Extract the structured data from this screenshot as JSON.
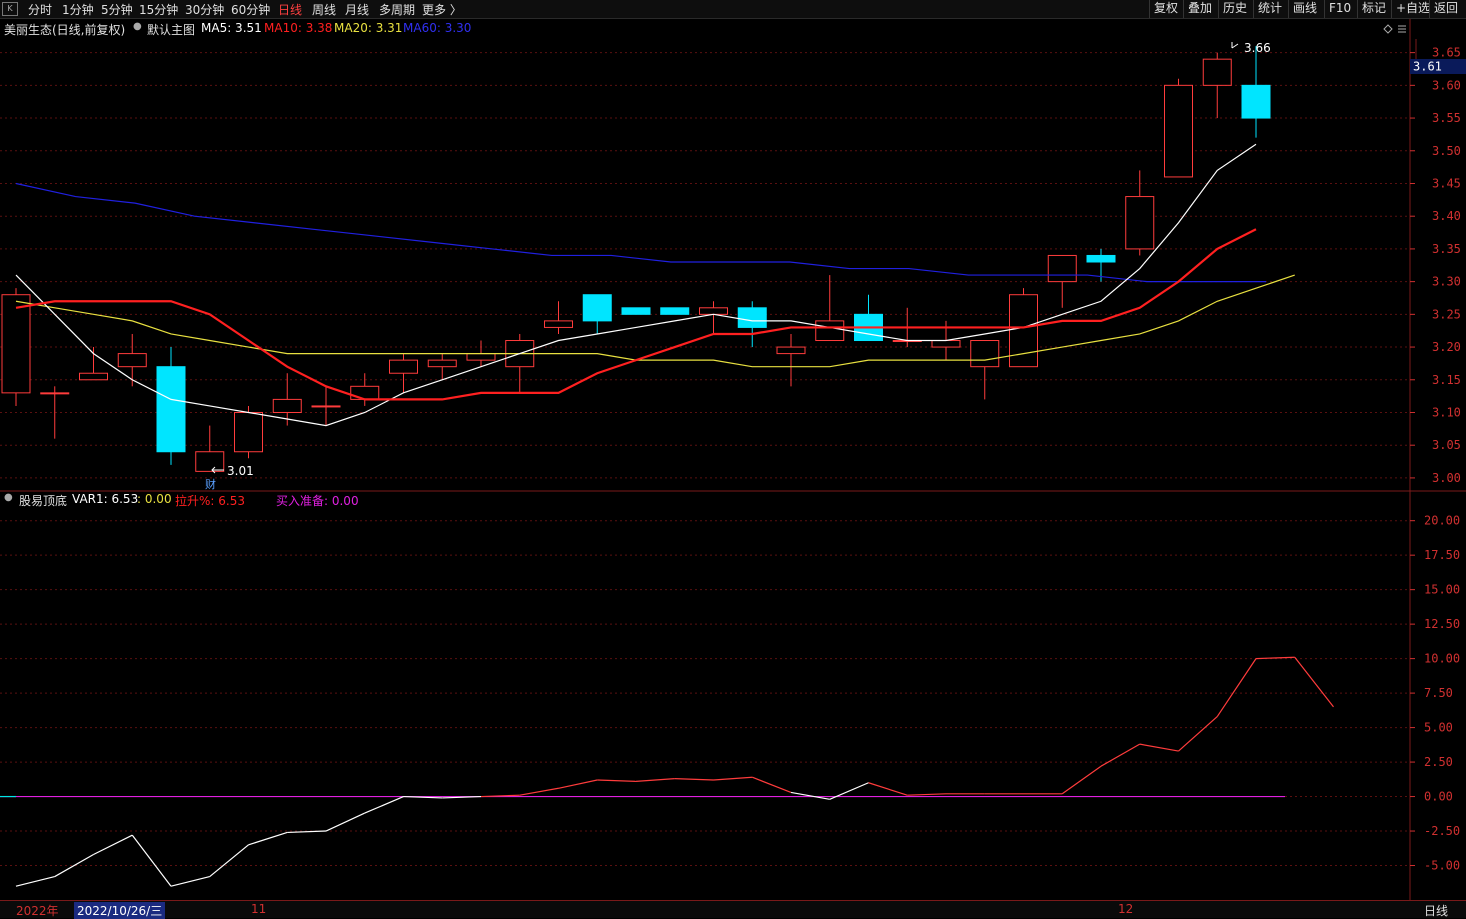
{
  "toolbar": {
    "periods": [
      "分时",
      "1分钟",
      "5分钟",
      "15分钟",
      "30分钟",
      "60分钟",
      "日线",
      "周线",
      "月线",
      "多周期",
      "更多 〉"
    ],
    "active_period": "日线",
    "right_buttons": [
      "复权",
      "叠加",
      "历史",
      "统计",
      "画线",
      "F10",
      "标记",
      "+自选",
      "返回"
    ]
  },
  "header": {
    "stock_title": "美丽生态(日线,前复权)",
    "template": "默认主图",
    "ma5": "MA5: 3.51",
    "ma10": "MA10: 3.38",
    "ma20": "MA20: 3.31",
    "ma60": "MA60: 3.30"
  },
  "indicator_header": {
    "name": "股易顶底",
    "var1": "VAR1: 6.53",
    "zero": ": 0.00",
    "lasheng": "拉升%: 6.53",
    "maiaru": "买入准备: 0.00"
  },
  "annotations": {
    "high": "3.66",
    "low": "3.01",
    "cai": "财",
    "current_price": "3.61"
  },
  "bottom_bar": {
    "year": "2022年",
    "date": "2022/10/26/三",
    "m11": "11",
    "m12": "12",
    "period": "日线"
  },
  "colors": {
    "up": "#ff3c3c",
    "down": "#00e5ff",
    "ma5": "#ffffff",
    "ma10": "#ff2020",
    "ma20": "#e8e040",
    "ma60": "#2020e0",
    "axis": "#d03030",
    "purple": "#e020e0"
  },
  "chart_data": [
    {
      "type": "candlestick",
      "title": "美丽生态(日线,前复权)",
      "y_ticks": [
        "3.65",
        "3.60",
        "3.55",
        "3.50",
        "3.45",
        "3.40",
        "3.35",
        "3.30",
        "3.25",
        "3.20",
        "3.15",
        "3.10",
        "3.05",
        "3.00"
      ],
      "ylim": [
        2.98,
        3.68
      ],
      "candles": [
        {
          "o": 3.13,
          "h": 3.29,
          "l": 3.11,
          "c": 3.28
        },
        {
          "o": 3.13,
          "h": 3.14,
          "l": 3.06,
          "c": 3.13
        },
        {
          "o": 3.15,
          "h": 3.2,
          "l": 3.15,
          "c": 3.16
        },
        {
          "o": 3.17,
          "h": 3.22,
          "l": 3.14,
          "c": 3.19
        },
        {
          "o": 3.17,
          "h": 3.2,
          "l": 3.02,
          "c": 3.04
        },
        {
          "o": 3.01,
          "h": 3.08,
          "l": 3.01,
          "c": 3.04
        },
        {
          "o": 3.04,
          "h": 3.11,
          "l": 3.03,
          "c": 3.1
        },
        {
          "o": 3.1,
          "h": 3.16,
          "l": 3.08,
          "c": 3.12
        },
        {
          "o": 3.11,
          "h": 3.14,
          "l": 3.08,
          "c": 3.11
        },
        {
          "o": 3.12,
          "h": 3.16,
          "l": 3.11,
          "c": 3.14
        },
        {
          "o": 3.16,
          "h": 3.19,
          "l": 3.13,
          "c": 3.18
        },
        {
          "o": 3.17,
          "h": 3.19,
          "l": 3.15,
          "c": 3.18
        },
        {
          "o": 3.18,
          "h": 3.21,
          "l": 3.17,
          "c": 3.19
        },
        {
          "o": 3.17,
          "h": 3.22,
          "l": 3.13,
          "c": 3.21
        },
        {
          "o": 3.23,
          "h": 3.27,
          "l": 3.22,
          "c": 3.24
        },
        {
          "o": 3.28,
          "h": 3.28,
          "l": 3.22,
          "c": 3.24
        },
        {
          "o": 3.26,
          "h": 3.26,
          "l": 3.25,
          "c": 3.25
        },
        {
          "o": 3.26,
          "h": 3.26,
          "l": 3.25,
          "c": 3.25
        },
        {
          "o": 3.25,
          "h": 3.27,
          "l": 3.22,
          "c": 3.26
        },
        {
          "o": 3.26,
          "h": 3.27,
          "l": 3.2,
          "c": 3.23
        },
        {
          "o": 3.19,
          "h": 3.22,
          "l": 3.14,
          "c": 3.2
        },
        {
          "o": 3.21,
          "h": 3.31,
          "l": 3.21,
          "c": 3.24
        },
        {
          "o": 3.25,
          "h": 3.28,
          "l": 3.21,
          "c": 3.21
        },
        {
          "o": 3.21,
          "h": 3.26,
          "l": 3.2,
          "c": 3.21
        },
        {
          "o": 3.2,
          "h": 3.24,
          "l": 3.18,
          "c": 3.21
        },
        {
          "o": 3.17,
          "h": 3.21,
          "l": 3.12,
          "c": 3.21
        },
        {
          "o": 3.17,
          "h": 3.29,
          "l": 3.17,
          "c": 3.28
        },
        {
          "o": 3.3,
          "h": 3.34,
          "l": 3.26,
          "c": 3.34
        },
        {
          "o": 3.34,
          "h": 3.35,
          "l": 3.3,
          "c": 3.33
        },
        {
          "o": 3.35,
          "h": 3.47,
          "l": 3.34,
          "c": 3.43
        },
        {
          "o": 3.46,
          "h": 3.61,
          "l": 3.46,
          "c": 3.6
        },
        {
          "o": 3.6,
          "h": 3.65,
          "l": 3.55,
          "c": 3.64
        },
        {
          "o": 3.6,
          "h": 3.66,
          "l": 3.52,
          "c": 3.55
        }
      ],
      "ma5": [
        3.31,
        3.25,
        3.19,
        3.15,
        3.12,
        3.11,
        3.1,
        3.09,
        3.08,
        3.1,
        3.13,
        3.15,
        3.17,
        3.19,
        3.21,
        3.22,
        3.23,
        3.24,
        3.25,
        3.24,
        3.24,
        3.23,
        3.22,
        3.21,
        3.21,
        3.22,
        3.23,
        3.25,
        3.27,
        3.32,
        3.39,
        3.47,
        3.51
      ],
      "ma10": [
        3.26,
        3.27,
        3.27,
        3.27,
        3.27,
        3.25,
        3.21,
        3.17,
        3.14,
        3.12,
        3.12,
        3.12,
        3.13,
        3.13,
        3.13,
        3.16,
        3.18,
        3.2,
        3.22,
        3.22,
        3.23,
        3.23,
        3.23,
        3.23,
        3.23,
        3.23,
        3.23,
        3.24,
        3.24,
        3.26,
        3.3,
        3.35,
        3.38
      ],
      "ma20": [
        3.27,
        3.26,
        3.25,
        3.24,
        3.22,
        3.21,
        3.2,
        3.19,
        3.19,
        3.19,
        3.19,
        3.19,
        3.19,
        3.19,
        3.19,
        3.19,
        3.18,
        3.18,
        3.18,
        3.17,
        3.17,
        3.17,
        3.18,
        3.18,
        3.18,
        3.18,
        3.19,
        3.2,
        3.21,
        3.22,
        3.24,
        3.27,
        3.29,
        3.31
      ],
      "ma60": [
        3.45,
        3.43,
        3.42,
        3.4,
        3.39,
        3.38,
        3.37,
        3.36,
        3.35,
        3.34,
        3.34,
        3.33,
        3.33,
        3.33,
        3.32,
        3.32,
        3.31,
        3.31,
        3.31,
        3.3,
        3.3,
        3.3
      ]
    },
    {
      "type": "line",
      "title": "股易顶底",
      "y_ticks": [
        "20.00",
        "17.50",
        "15.00",
        "12.50",
        "10.00",
        "7.50",
        "5.00",
        "2.50",
        "0.00",
        "-2.50",
        "-5.00"
      ],
      "ylim": [
        -7.5,
        21.5
      ],
      "var1": [
        -6.5,
        -5.8,
        -4.2,
        -2.8,
        -6.5,
        -5.8,
        -3.5,
        -2.6,
        -2.5,
        -1.2,
        0.0,
        -0.1,
        0.0,
        0.1,
        0.6,
        1.2,
        1.1,
        1.3,
        1.2,
        1.4,
        0.3,
        -0.2,
        1.0,
        0.1,
        0.2,
        0.2,
        0.2,
        0.2,
        2.2,
        3.8,
        3.3,
        5.8,
        10.0,
        10.1,
        6.5
      ],
      "zero_line": 0.0
    }
  ]
}
